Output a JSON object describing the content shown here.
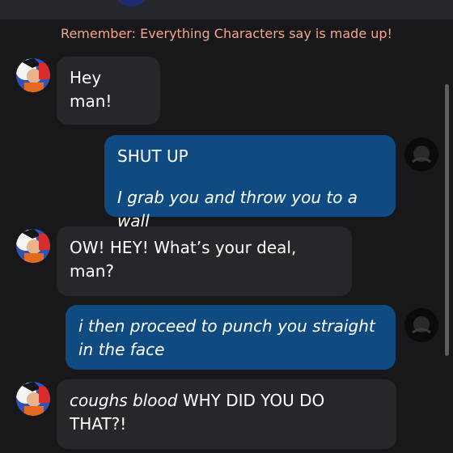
{
  "disclaimer": "Remember: Everything Characters say is made up!",
  "messages": [
    {
      "sender": "character",
      "text": "Hey man!"
    },
    {
      "sender": "user",
      "lines": [
        "SHUT UP",
        "I grab you and throw you to a wall"
      ]
    },
    {
      "sender": "character",
      "text": "OW! HEY! What’s your deal, man?"
    },
    {
      "sender": "user",
      "text": "i then proceed to punch you straight in the face"
    },
    {
      "sender": "character",
      "action": "coughs blood",
      "text": " WHY DID YOU DO THAT?!"
    }
  ],
  "colors": {
    "background": "#18181b",
    "character_bubble": "#26272b",
    "user_bubble": "#0f4b80",
    "disclaimer_text": "#f4a48c"
  },
  "icons": {
    "character_avatar": "character-avatar",
    "user_avatar": "user-avatar"
  }
}
